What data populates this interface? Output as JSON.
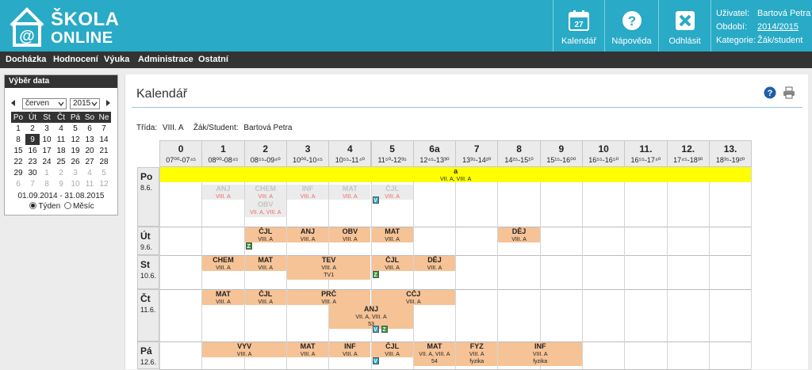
{
  "header": {
    "logo": {
      "line1": "ŠKOLA",
      "line2": "ONLINE",
      "icon": "house-at-icon"
    },
    "buttons": [
      {
        "label": "Kalendář",
        "icon": "calendar-icon",
        "badge": "27"
      },
      {
        "label": "Nápověda",
        "icon": "help-icon"
      },
      {
        "label": "Odhlásit",
        "icon": "logout-icon"
      }
    ],
    "user": {
      "user_label": "Uživatel:",
      "user_value": "Bartová Petra",
      "period_label": "Období:",
      "period_value": "2014/2015",
      "category_label": "Kategorie:",
      "category_value": "Žák/student"
    }
  },
  "menu": [
    "Docházka",
    "Hodnocení",
    "Výuka",
    "Administrace",
    "Ostatní"
  ],
  "sidebar": {
    "title": "Výběr data",
    "month": "červen",
    "year": "2015",
    "weekdays": [
      "Po",
      "Út",
      "St",
      "Čt",
      "Pá",
      "So",
      "Ne"
    ],
    "weeks": [
      [
        "1",
        "2",
        "3",
        "4",
        "5",
        "6",
        "7"
      ],
      [
        "8",
        "9",
        "10",
        "11",
        "12",
        "13",
        "14"
      ],
      [
        "15",
        "16",
        "17",
        "18",
        "19",
        "20",
        "21"
      ],
      [
        "22",
        "23",
        "24",
        "25",
        "26",
        "27",
        "28"
      ],
      [
        "29",
        "30",
        "1",
        "2",
        "3",
        "4",
        "5"
      ],
      [
        "6",
        "7",
        "8",
        "9",
        "10",
        "11",
        "12"
      ]
    ],
    "selected_day": "9",
    "range": "01.09.2014 - 31.08.2015",
    "view_week": "Týden",
    "view_month": "Měsíc",
    "view_selected": "Týden"
  },
  "main": {
    "title": "Kalendář",
    "class_label": "Třída:",
    "class_value": "VIII. A",
    "student_label": "Žák/Student:",
    "student_value": "Bartová Petra"
  },
  "schedule": {
    "periods": [
      {
        "n": "0",
        "t": "07⁰⁰-07⁴⁵"
      },
      {
        "n": "1",
        "t": "08⁰⁰-08⁴⁵"
      },
      {
        "n": "2",
        "t": "08⁵⁵-09⁴⁰"
      },
      {
        "n": "3",
        "t": "10⁰⁰-10⁴⁵"
      },
      {
        "n": "4",
        "t": "10⁵⁵-11⁴⁰"
      },
      {
        "n": "5",
        "t": "11⁵⁰-12³⁵"
      },
      {
        "n": "6a",
        "t": "12⁴⁵-13³⁰"
      },
      {
        "n": "7",
        "t": "13³⁵-14²⁰"
      },
      {
        "n": "8",
        "t": "14²⁵-15¹⁰"
      },
      {
        "n": "9",
        "t": "15¹⁵-16⁰⁰"
      },
      {
        "n": "10",
        "t": "16⁵⁵-16⁵⁰"
      },
      {
        "n": "11.",
        "t": "16⁵⁵-17⁴⁰"
      },
      {
        "n": "12.",
        "t": "17⁴⁵-18³⁰"
      },
      {
        "n": "13.",
        "t": "18³⁵-19²⁰"
      }
    ],
    "days": [
      {
        "name": "Po",
        "date": "8.6."
      },
      {
        "name": "Út",
        "date": "9.6."
      },
      {
        "name": "St",
        "date": "10.6."
      },
      {
        "name": "Čt",
        "date": "11.6."
      },
      {
        "name": "Pá",
        "date": "12.6."
      }
    ],
    "events": [
      {
        "day": 0,
        "p": 0,
        "span": 14,
        "sub": 0,
        "subh": 1,
        "type": "yel",
        "subject": "a",
        "classes": "VII. A, VIII. A",
        "room": ""
      },
      {
        "day": 0,
        "p": 1,
        "span": 1,
        "sub": 1,
        "subh": 1,
        "type": "dim",
        "subject": "ANJ",
        "classes": "VIII. A",
        "room": ""
      },
      {
        "day": 0,
        "p": 2,
        "span": 1,
        "sub": 1,
        "subh": 1,
        "type": "dim",
        "subject": "CHEM",
        "classes": "VIII. A",
        "room": "39"
      },
      {
        "day": 0,
        "p": 2,
        "span": 1,
        "sub": 2,
        "subh": 1,
        "type": "dim",
        "subject": "OBV",
        "classes": "VII. A, VIII. A",
        "room": "39"
      },
      {
        "day": 0,
        "p": 3,
        "span": 1,
        "sub": 1,
        "subh": 1,
        "type": "dim",
        "subject": "INF",
        "classes": "VIII. A",
        "room": ""
      },
      {
        "day": 0,
        "p": 4,
        "span": 1,
        "sub": 1,
        "subh": 1,
        "type": "dim",
        "subject": "MAT",
        "classes": "VIII. A",
        "room": ""
      },
      {
        "day": 0,
        "p": 5,
        "span": 1,
        "sub": 1,
        "subh": 1,
        "type": "dim",
        "subject": "ČJL",
        "classes": "VIII. A",
        "room": ""
      },
      {
        "day": 1,
        "p": 2,
        "span": 1,
        "sub": 0,
        "subh": 1,
        "type": "lesson",
        "subject": "ČJL",
        "classes": "VIII. A",
        "room": ""
      },
      {
        "day": 1,
        "p": 3,
        "span": 1,
        "sub": 0,
        "subh": 1,
        "type": "lesson",
        "subject": "ANJ",
        "classes": "VIII. A",
        "room": ""
      },
      {
        "day": 1,
        "p": 4,
        "span": 1,
        "sub": 0,
        "subh": 1,
        "type": "lesson",
        "subject": "OBV",
        "classes": "VIII. A",
        "room": ""
      },
      {
        "day": 1,
        "p": 5,
        "span": 1,
        "sub": 0,
        "subh": 1,
        "type": "lesson",
        "subject": "MAT",
        "classes": "VIII. A",
        "room": ""
      },
      {
        "day": 1,
        "p": 8,
        "span": 1,
        "sub": 0,
        "subh": 1,
        "type": "lesson",
        "subject": "DĚJ",
        "classes": "VIII. A",
        "room": ""
      },
      {
        "day": 2,
        "p": 1,
        "span": 1,
        "sub": 0,
        "subh": 1,
        "type": "lesson",
        "subject": "CHEM",
        "classes": "VIII. A",
        "room": ""
      },
      {
        "day": 2,
        "p": 2,
        "span": 1,
        "sub": 0,
        "subh": 1,
        "type": "lesson",
        "subject": "MAT",
        "classes": "VIII. A",
        "room": ""
      },
      {
        "day": 2,
        "p": 3,
        "span": 2,
        "sub": 0,
        "subh": 1,
        "type": "lesson",
        "subject": "TEV",
        "classes": "VIII. A",
        "room": "TV1"
      },
      {
        "day": 2,
        "p": 5,
        "span": 1,
        "sub": 0,
        "subh": 1,
        "type": "lesson",
        "subject": "ČJL",
        "classes": "VIII. A",
        "room": ""
      },
      {
        "day": 2,
        "p": 6,
        "span": 1,
        "sub": 0,
        "subh": 1,
        "type": "lesson",
        "subject": "DĚJ",
        "classes": "VIII. A",
        "room": ""
      },
      {
        "day": 3,
        "p": 1,
        "span": 1,
        "sub": 0,
        "subh": 1,
        "type": "lesson",
        "subject": "MAT",
        "classes": "VIII. A",
        "room": ""
      },
      {
        "day": 3,
        "p": 2,
        "span": 1,
        "sub": 0,
        "subh": 1,
        "type": "lesson",
        "subject": "ČJL",
        "classes": "VIII. A",
        "room": ""
      },
      {
        "day": 3,
        "p": 3,
        "span": 2,
        "sub": 0,
        "subh": 1,
        "type": "lesson",
        "subject": "PRČ",
        "classes": "VIII. A",
        "room": ""
      },
      {
        "day": 3,
        "p": 5,
        "span": 2,
        "sub": 0,
        "subh": 1,
        "type": "lesson",
        "subject": "CČJ",
        "classes": "VIII. A",
        "room": ""
      },
      {
        "day": 3,
        "p": 4,
        "span": 2,
        "sub": 1,
        "subh": 1.5,
        "type": "lesson",
        "subject": "ANJ",
        "classes": "VII. A, VIII. A",
        "room": "53"
      },
      {
        "day": 4,
        "p": 1,
        "span": 2,
        "sub": 0,
        "subh": 1,
        "type": "lesson",
        "subject": "VYV",
        "classes": "VIII. A",
        "room": ""
      },
      {
        "day": 4,
        "p": 3,
        "span": 1,
        "sub": 0,
        "subh": 1,
        "type": "lesson",
        "subject": "MAT",
        "classes": "VIII. A",
        "room": ""
      },
      {
        "day": 4,
        "p": 4,
        "span": 1,
        "sub": 0,
        "subh": 1,
        "type": "lesson",
        "subject": "INF",
        "classes": "VIII. A",
        "room": ""
      },
      {
        "day": 4,
        "p": 5,
        "span": 1,
        "sub": 0,
        "subh": 1,
        "type": "lesson",
        "subject": "ČJL",
        "classes": "VIII. A",
        "room": ""
      },
      {
        "day": 4,
        "p": 6,
        "span": 1,
        "sub": 0,
        "subh": 1,
        "type": "lesson",
        "subject": "MAT",
        "classes": "VII. A, VIII. A",
        "room": "54"
      },
      {
        "day": 4,
        "p": 7,
        "span": 1,
        "sub": 0,
        "subh": 1,
        "type": "lesson",
        "subject": "FYZ",
        "classes": "VIII. A",
        "room": "fyzika"
      },
      {
        "day": 4,
        "p": 8,
        "span": 2,
        "sub": 0,
        "subh": 1,
        "type": "lesson",
        "subject": "INF",
        "classes": "VIII. A",
        "room": "fyzika"
      }
    ],
    "badges": [
      {
        "day": 0,
        "p": 5,
        "row": 2,
        "off": 0,
        "kind": "v",
        "label": "V"
      },
      {
        "day": 1,
        "p": 2,
        "row": 1,
        "off": 0,
        "kind": "z",
        "label": "Z"
      },
      {
        "day": 2,
        "p": 5,
        "row": 1,
        "off": 0,
        "kind": "z",
        "label": "Z"
      },
      {
        "day": 3,
        "p": 5,
        "row": 2.5,
        "off": 0,
        "kind": "v",
        "label": "V"
      },
      {
        "day": 3,
        "p": 5,
        "row": 2.5,
        "off": 1,
        "kind": "z",
        "label": "Z"
      },
      {
        "day": 4,
        "p": 5,
        "row": 1,
        "off": 0,
        "kind": "v",
        "label": "V"
      }
    ]
  }
}
